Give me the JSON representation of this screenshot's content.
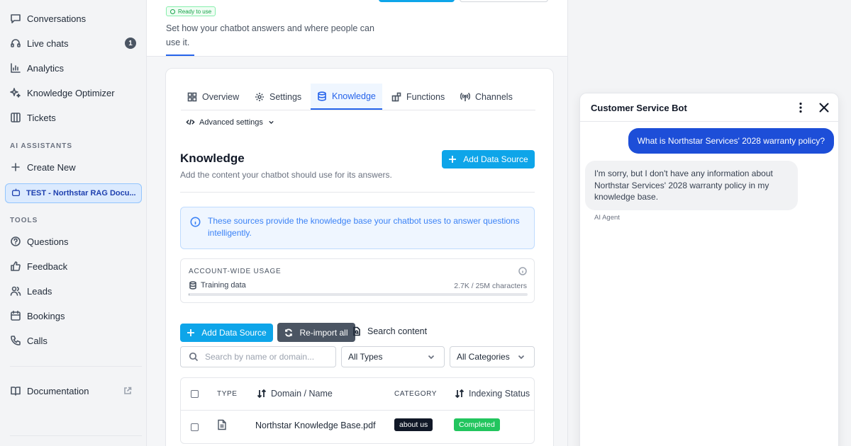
{
  "sidebar": {
    "items": [
      {
        "label": "Conversations",
        "icon": "message-icon"
      },
      {
        "label": "Live chats",
        "icon": "headset-icon",
        "badge": "1"
      },
      {
        "label": "Analytics",
        "icon": "chart-icon"
      },
      {
        "label": "Knowledge Optimizer",
        "icon": "sparkle-icon"
      },
      {
        "label": "Tickets",
        "icon": "ticket-icon"
      }
    ],
    "ai_section_label": "AI ASSISTANTS",
    "create_new": "Create New",
    "active_assistant": "TEST - Northstar RAG Docu...",
    "tools_section_label": "TOOLS",
    "tools": [
      {
        "label": "Questions",
        "icon": "question-icon"
      },
      {
        "label": "Feedback",
        "icon": "thumbs-up-icon"
      },
      {
        "label": "Leads",
        "icon": "users-icon"
      },
      {
        "label": "Bookings",
        "icon": "calendar-icon"
      },
      {
        "label": "Calls",
        "icon": "phone-icon"
      }
    ],
    "documentation": "Documentation"
  },
  "header": {
    "status_badge": "Ready to use",
    "description": "Set how your chatbot answers and where people can use it."
  },
  "tabs": [
    {
      "label": "Overview",
      "icon": "grid-icon"
    },
    {
      "label": "Settings",
      "icon": "gear-icon"
    },
    {
      "label": "Knowledge",
      "icon": "database-icon",
      "active": true
    },
    {
      "label": "Functions",
      "icon": "functions-icon"
    },
    {
      "label": "Channels",
      "icon": "broadcast-icon"
    }
  ],
  "advanced_settings": "Advanced settings",
  "knowledge": {
    "title": "Knowledge",
    "subtitle": "Add the content your chatbot should use for its answers.",
    "add_button": "Add Data Source",
    "info": "These sources provide the knowledge base your chatbot uses to answer questions intelligently.",
    "usage": {
      "label": "ACCOUNT-WIDE USAGE",
      "row_label": "Training data",
      "value": "2.7K / 25M characters",
      "fraction": 0.0001
    },
    "actions": {
      "add": "Add Data Source",
      "reimport": "Re-import all",
      "search_content": "Search content"
    },
    "filters": {
      "search_placeholder": "Search by name or domain...",
      "type": "All Types",
      "category": "All Categories"
    },
    "table": {
      "headers": {
        "type": "TYPE",
        "name": "Domain / Name",
        "category": "CATEGORY",
        "status": "Indexing Status"
      },
      "rows": [
        {
          "type_icon": "document-icon",
          "name": "Northstar Knowledge Base.pdf",
          "category": "about us",
          "status": "Completed"
        }
      ]
    }
  },
  "chat": {
    "title": "Customer Service Bot",
    "user_message": "What is Northstar Services' 2028 warranty policy?",
    "bot_message": "I'm sorry, but I don't have any information about Northstar Services' 2028 warranty policy in my knowledge base.",
    "bot_author": "AI Agent"
  },
  "colors": {
    "accent": "#0ea5e9",
    "tab_active": "#2563eb",
    "user_bubble": "#1d4ed8",
    "status_completed": "#22c55e",
    "category_badge": "#111827"
  }
}
